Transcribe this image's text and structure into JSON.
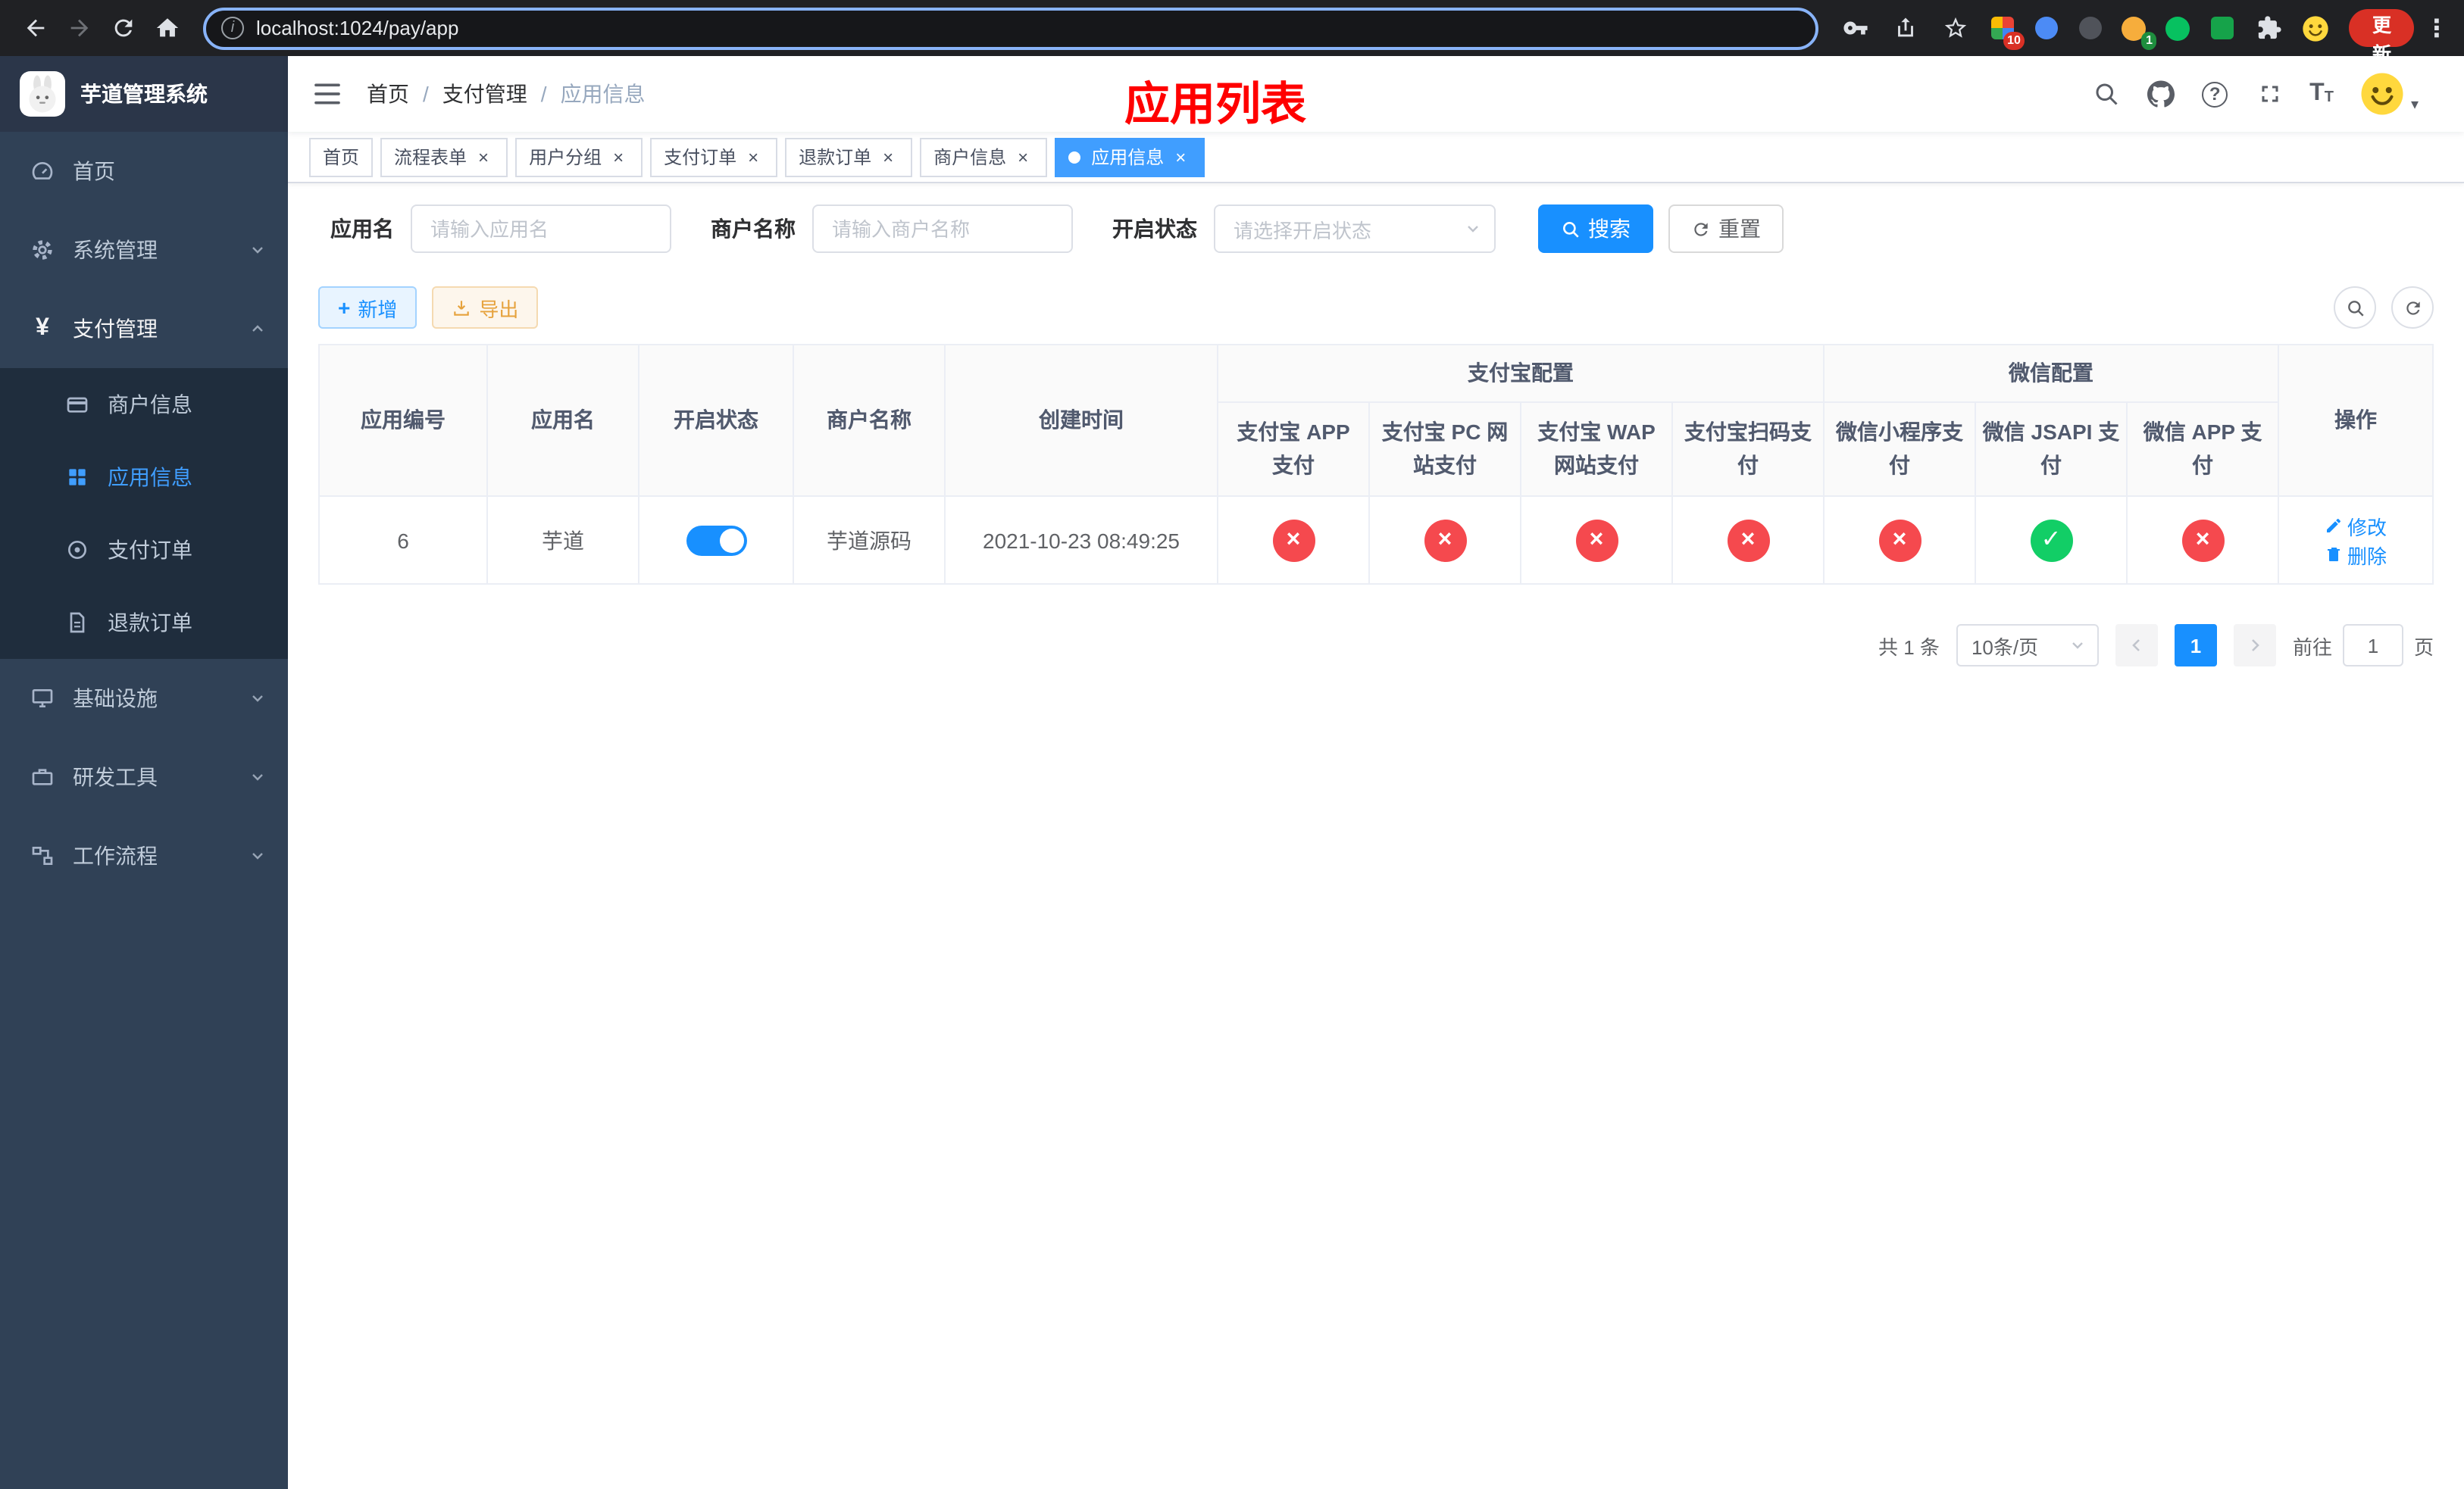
{
  "colors": {
    "primary": "#1890ff",
    "tag_active_blue": "#409eff",
    "danger_red": "#f5494e",
    "success_green": "#12ce66",
    "title_red": "#ff0000",
    "sidebar_bg": "#304156",
    "submenu_bg": "#1f2d3d",
    "update_chip": "#d93025"
  },
  "icons": {
    "check": "✓",
    "cross": "×",
    "yen": "¥",
    "plus": "+",
    "question": "?",
    "info": "i",
    "menu_dots": "⋮",
    "font_large": "T",
    "font_small": "T",
    "caret": "▾",
    "close": "×"
  },
  "browser": {
    "url": "localhost:1024/pay/app",
    "update_label": "更新",
    "extension_badge_grid": "10",
    "extension_badge_avatar": "1"
  },
  "sidebar": {
    "logo_title": "芋道管理系统",
    "menu": [
      {
        "label": "首页"
      },
      {
        "label": "系统管理"
      },
      {
        "label": "支付管理"
      },
      {
        "label": "基础设施"
      },
      {
        "label": "研发工具"
      },
      {
        "label": "工作流程"
      }
    ],
    "submenu": [
      {
        "label": "商户信息"
      },
      {
        "label": "应用信息"
      },
      {
        "label": "支付订单"
      },
      {
        "label": "退款订单"
      }
    ]
  },
  "navbar": {
    "breadcrumb": [
      "首页",
      "支付管理",
      "应用信息"
    ],
    "separator": "/",
    "page_title": "应用列表"
  },
  "tabs": [
    {
      "label": "首页"
    },
    {
      "label": "流程表单"
    },
    {
      "label": "用户分组"
    },
    {
      "label": "支付订单"
    },
    {
      "label": "退款订单"
    },
    {
      "label": "商户信息"
    },
    {
      "label": "应用信息"
    }
  ],
  "filters": {
    "app_name_label": "应用名",
    "app_name_placeholder": "请输入应用名",
    "merchant_label": "商户名称",
    "merchant_placeholder": "请输入商户名称",
    "status_label": "开启状态",
    "status_placeholder": "请选择开启状态",
    "search_label": "搜索",
    "reset_label": "重置"
  },
  "toolbar": {
    "add_label": "新增",
    "export_label": "导出"
  },
  "table": {
    "headers": {
      "app_id": "应用编号",
      "app_name": "应用名",
      "status": "开启状态",
      "merchant": "商户名称",
      "created": "创建时间",
      "alipay_group": "支付宝配置",
      "wechat_group": "微信配置",
      "alipay_app": "支付宝 APP 支付",
      "alipay_pc": "支付宝 PC 网站支付",
      "alipay_wap": "支付宝 WAP 网站支付",
      "alipay_qr": "支付宝扫码支付",
      "wechat_lite": "微信小程序支付",
      "wechat_jsapi": "微信 JSAPI 支付",
      "wechat_app": "微信 APP 支付",
      "actions": "操作"
    },
    "row": {
      "app_id": "6",
      "app_name": "芋道",
      "enabled": true,
      "merchant": "芋道源码",
      "created": "2021-10-23 08:49:25",
      "configs": [
        false,
        false,
        false,
        false,
        false,
        true,
        false
      ],
      "edit_label": "修改",
      "delete_label": "删除"
    }
  },
  "pagination": {
    "total": "共 1 条",
    "page_size": "10条/页",
    "page": "1",
    "goto_prefix": "前往",
    "goto_value": "1",
    "goto_suffix": "页"
  }
}
